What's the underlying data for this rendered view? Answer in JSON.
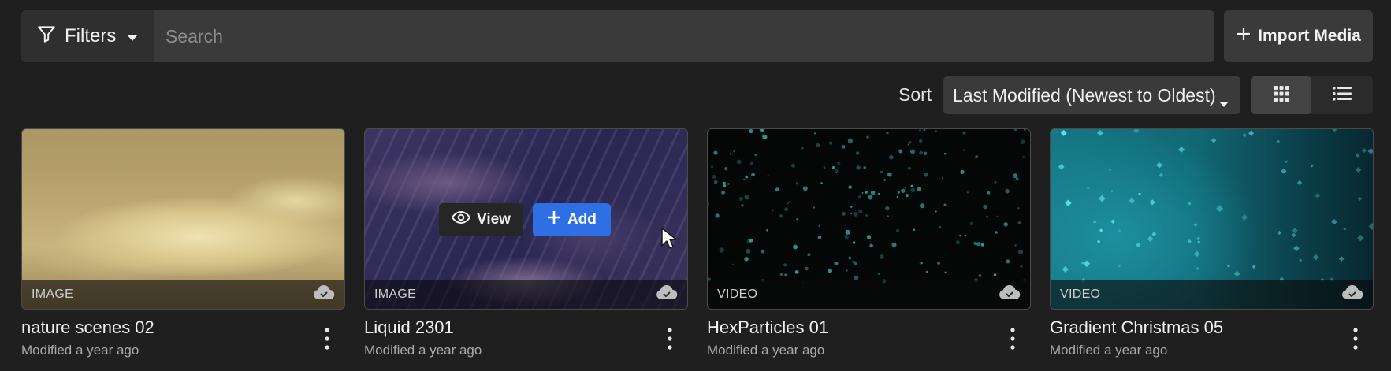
{
  "toolbar": {
    "filters_label": "Filters",
    "search_placeholder": "Search",
    "search_value": "",
    "import_label": "Import Media"
  },
  "sort": {
    "label": "Sort",
    "selected": "Last Modified (Newest to Oldest)"
  },
  "view_modes": [
    "grid",
    "list"
  ],
  "overlay": {
    "view_label": "View",
    "add_label": "Add"
  },
  "cards": [
    {
      "type": "IMAGE",
      "title": "nature scenes 02",
      "modified": "Modified a year ago"
    },
    {
      "type": "IMAGE",
      "title": "Liquid 2301",
      "modified": "Modified a year ago"
    },
    {
      "type": "VIDEO",
      "title": "HexParticles 01",
      "modified": "Modified a year ago"
    },
    {
      "type": "VIDEO",
      "title": "Gradient Christmas 05",
      "modified": "Modified a year ago"
    }
  ],
  "colors": {
    "accent": "#2f6fe4",
    "background": "#1f1f20",
    "panel": "#3a3a3b"
  }
}
